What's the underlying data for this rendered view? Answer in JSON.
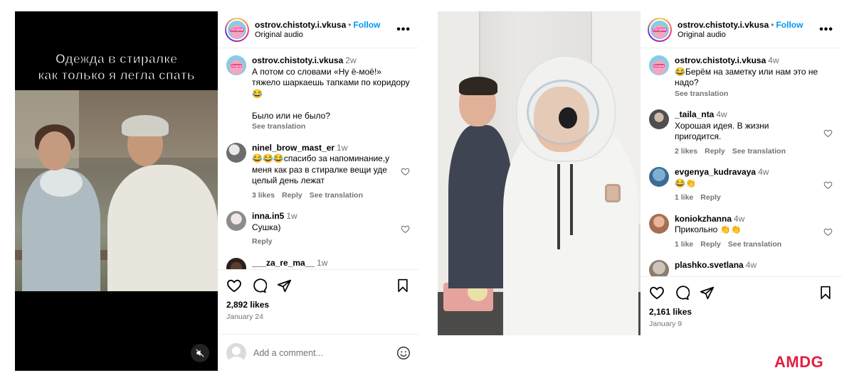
{
  "colors": {
    "link": "#0095f6",
    "muted": "#737373",
    "brand": "#e31e41"
  },
  "post1": {
    "video_caption_line1": "Одежда в стиралке",
    "video_caption_line2": "как только я легла спать",
    "mute_icon": "speaker-muted-icon",
    "header": {
      "username": "ostrov.chistoty.i.vkusa",
      "separator": "•",
      "follow": "Follow",
      "subtitle": "Original audio",
      "more": "•••"
    },
    "comments": [
      {
        "user": "ostrov.chistoty.i.vkusa",
        "time": "2w",
        "text": "А потом со словами «Ну ё-моё!» тяжело шаркаешь тапками по коридору😂\n\nБыло или не было?",
        "see_translation": "See translation"
      },
      {
        "user": "ninel_brow_mast_er",
        "time": "1w",
        "text": "😂😂😂спасибо за напоминание,у меня как раз в стиралке вещи уде целый день лежат",
        "likes": "3 likes",
        "reply": "Reply",
        "see_translation": "See translation"
      },
      {
        "user": "inna.in5",
        "time": "1w",
        "text": "Сушка)",
        "reply": "Reply"
      },
      {
        "user": "___za_re_ma__",
        "time": "1w"
      }
    ],
    "likes": "2,892 likes",
    "date": "January 24",
    "add_comment_placeholder": "Add a comment..."
  },
  "post2": {
    "header": {
      "username": "ostrov.chistoty.i.vkusa",
      "separator": "•",
      "follow": "Follow",
      "subtitle": "Original audio",
      "more": "•••"
    },
    "comments": [
      {
        "user": "ostrov.chistoty.i.vkusa",
        "time": "4w",
        "text": "😂Берём на заметку или нам это не надо?",
        "see_translation": "See translation"
      },
      {
        "user": "_taila_nta",
        "time": "4w",
        "text": "Хорошая идея. В жизни пригодится.",
        "likes": "2 likes",
        "reply": "Reply",
        "see_translation": "See translation"
      },
      {
        "user": "evgenya_kudravaya",
        "time": "4w",
        "text": "😂👏",
        "likes": "1 like",
        "reply": "Reply"
      },
      {
        "user": "koniokzhanna",
        "time": "4w",
        "text": "Прикольно 👏👏",
        "likes": "1 like",
        "reply": "Reply",
        "see_translation": "See translation"
      },
      {
        "user": "plashko.svetlana",
        "time": "4w"
      }
    ],
    "likes": "2,161 likes",
    "date": "January 9"
  },
  "brand": "AMDG"
}
